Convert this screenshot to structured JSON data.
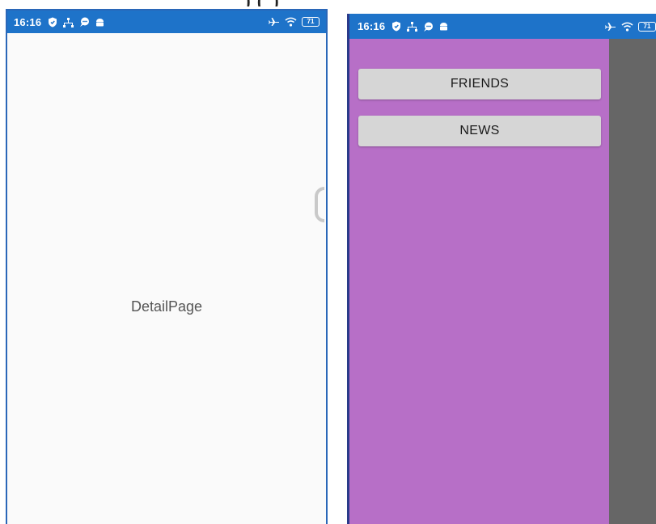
{
  "caption": {
    "text": ")      (           )"
  },
  "left_screen": {
    "status_bar": {
      "time": "16:16",
      "icons_left": [
        "shield-icon",
        "network-icon",
        "chat-icon",
        "android-icon"
      ],
      "icons_right": [
        "airplane-icon",
        "wifi-icon",
        "battery-icon"
      ],
      "battery_level": "71"
    },
    "detail_label": "DetailPage"
  },
  "right_screen": {
    "status_bar": {
      "time": "16:16",
      "icons_left": [
        "shield-icon",
        "network-icon",
        "chat-icon",
        "android-icon"
      ],
      "icons_right": [
        "airplane-icon",
        "wifi-icon",
        "battery-icon"
      ],
      "battery_level": "71"
    },
    "menu": {
      "friends_label": "FRIENDS",
      "news_label": "NEWS"
    }
  },
  "colors": {
    "status_bar": "#1e73c9",
    "drawer": "#b76fc7",
    "scrim": "#666666",
    "button": "#d6d6d6",
    "detail_background": "#fafafa"
  }
}
